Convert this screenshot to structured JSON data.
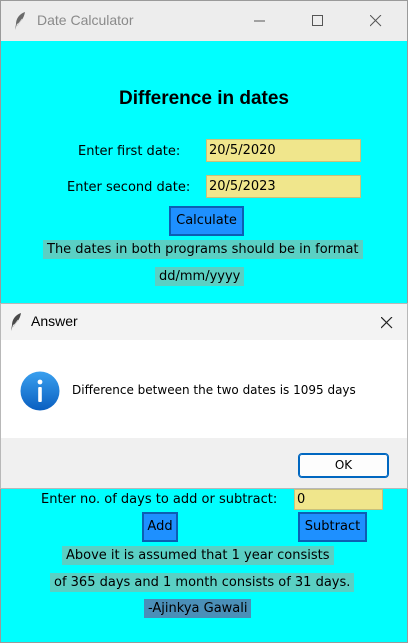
{
  "window": {
    "title": "Date Calculator"
  },
  "main": {
    "heading": "Difference in dates",
    "first_date_label": "Enter first date:",
    "first_date_value": "20/5/2020",
    "second_date_label": "Enter second date:",
    "second_date_value": "20/5/2023",
    "calculate_label": "Calculate",
    "format_note_line1": "The dates in both programs should be in format",
    "format_note_line2": "dd/mm/yyyy",
    "days_label": "Enter no. of days to add or subtract:",
    "days_value": "0",
    "add_label": "Add",
    "subtract_label": "Subtract",
    "assumption_line1": "Above it is assumed that 1 year consists",
    "assumption_line2": "of 365 days and 1 month consists of 31 days.",
    "author": "-Ajinkya Gawali"
  },
  "dialog": {
    "title": "Answer",
    "message": "Difference between the two dates is 1095 days",
    "ok_label": "OK",
    "icon": "info-icon"
  },
  "colors": {
    "window_bg": "#00ffff",
    "entry_bg": "#f0e68c",
    "button_bg": "#1e90ff",
    "note_bg": "#5ad0c4",
    "author_bg": "#4a8fb8",
    "info_blue": "#0a6fd1"
  }
}
